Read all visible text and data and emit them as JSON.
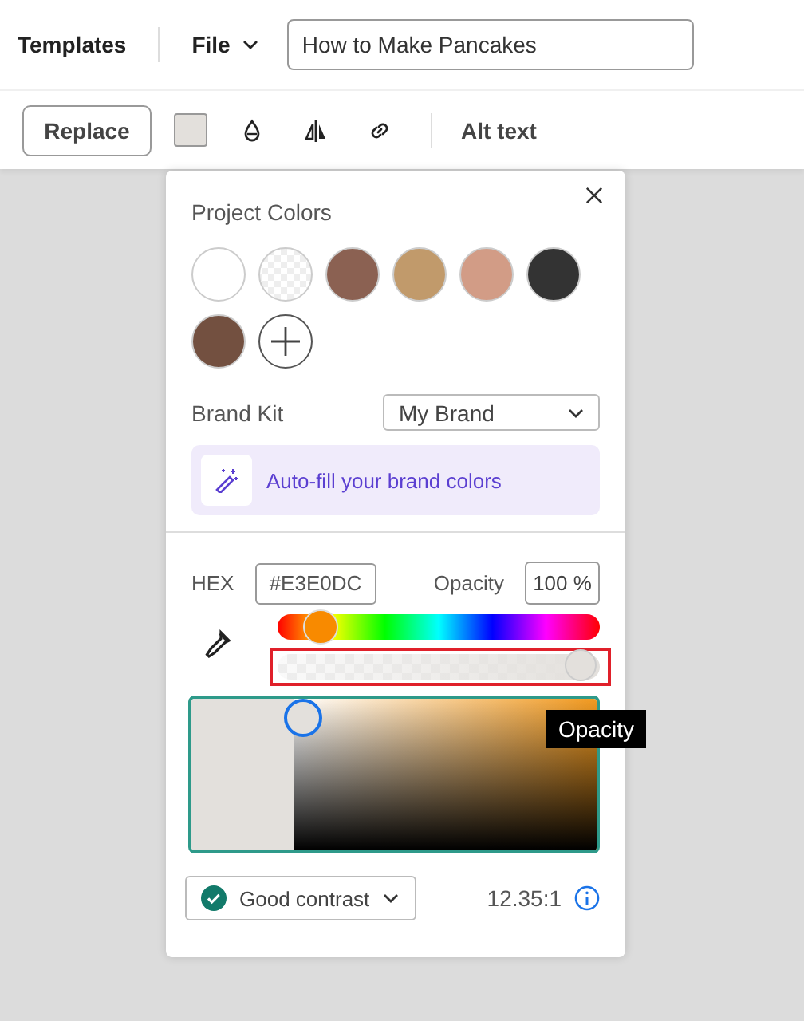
{
  "header": {
    "title": "Templates",
    "file_menu": "File",
    "document_name": "How to Make Pancakes"
  },
  "toolbar": {
    "replace": "Replace",
    "alt_text": "Alt text"
  },
  "color_panel": {
    "section_title": "Project Colors",
    "swatches": [
      {
        "kind": "solid",
        "color": "#ffffff"
      },
      {
        "kind": "transparent",
        "color": "#ffffff"
      },
      {
        "kind": "solid",
        "color": "#8b6152"
      },
      {
        "kind": "solid",
        "color": "#c19a6b"
      },
      {
        "kind": "solid",
        "color": "#d29c86"
      },
      {
        "kind": "solid",
        "color": "#333333"
      },
      {
        "kind": "solid",
        "color": "#735040"
      },
      {
        "kind": "add"
      }
    ],
    "brand_kit_label": "Brand Kit",
    "brand_kit_value": "My Brand",
    "autofill": "Auto-fill your brand colors",
    "hex_label": "HEX",
    "hex_value": "#E3E0DC",
    "opacity_label": "Opacity",
    "opacity_value": "100 %",
    "hue": {
      "level": 0.09
    },
    "opacity_slider": {
      "level": 1,
      "highlighted": true
    },
    "tooltip": "Opacity",
    "contrast": "Good contrast",
    "ratio": "12.35:1"
  }
}
